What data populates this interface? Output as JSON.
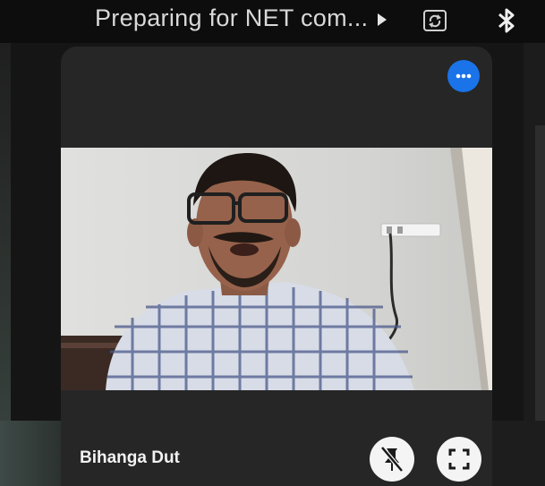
{
  "header": {
    "title": "Preparing for NET com...",
    "icons": [
      "play-arrow-icon",
      "screen-rotation-icon",
      "bluetooth-icon"
    ]
  },
  "participant": {
    "name": "Bihanga Dut"
  },
  "controls": {
    "more_options_icon": "more-horizontal-icon",
    "unpin_icon": "pin-off-icon",
    "fullscreen_icon": "fullscreen-icon"
  },
  "colors": {
    "accent": "#1a73e8",
    "tile_background": "#262626",
    "label_text": "#f2f2f2"
  }
}
